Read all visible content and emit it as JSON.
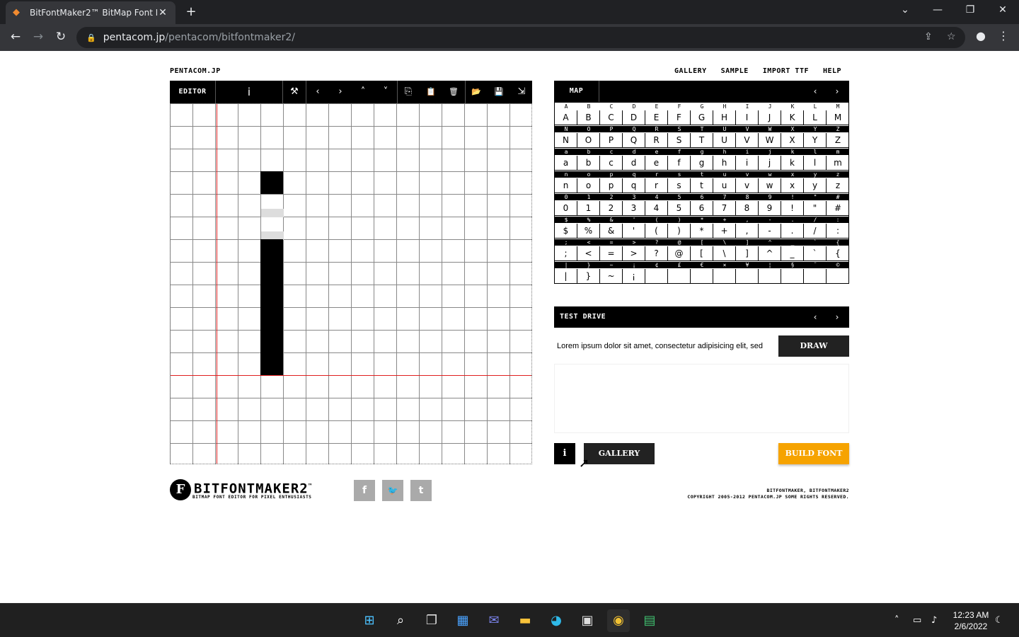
{
  "browser": {
    "tab_title": "BitFontMaker2™ BitMap Font Ed",
    "tab_close": "✕",
    "new_tab": "+",
    "url_host": "pentacom.jp",
    "url_path": "/pentacom/bitfontmaker2/",
    "win_min": "—",
    "win_max": "❐",
    "win_close": "✕",
    "tab_list": "⌄"
  },
  "site": {
    "name": "PENTACOM.JP",
    "nav": [
      "GALLERY",
      "SAMPLE",
      "IMPORT TTF",
      "HELP"
    ]
  },
  "editor": {
    "label": "EDITOR",
    "current_glyph": "i",
    "tools": {
      "magic": "⚒",
      "left": "‹",
      "right": "›",
      "up": "˄",
      "down": "˅",
      "copy": "⎘",
      "paste": "📋",
      "delete": "🗑",
      "open": "📂",
      "save": "💾",
      "export": "⇲"
    },
    "grid_cols": 16,
    "grid_rows": 16,
    "filled_pixels": [
      [
        4,
        3
      ],
      [
        4,
        6
      ],
      [
        4,
        7
      ],
      [
        4,
        8
      ],
      [
        4,
        9
      ],
      [
        4,
        10
      ],
      [
        4,
        11
      ]
    ],
    "ghost_pixels": [
      [
        4,
        4
      ],
      [
        4,
        5
      ]
    ],
    "guide_col": 2,
    "guide_row": 12
  },
  "footer": {
    "logo_badge": "F",
    "logo_name": "BITFONTMAKER2",
    "logo_tm": "™",
    "logo_sub": "BITMAP FONT EDITOR FOR PIXEL ENTHUSIASTS",
    "social": [
      "f",
      "🐦",
      "t"
    ],
    "copyright_line1": "BITFONTMAKER, BITFONTMAKER2",
    "copyright_line2": "COPYRIGHT 2005-2012 PENTACOM.JP SOME RIGHTS RESERVED."
  },
  "map": {
    "label": "MAP",
    "prev": "‹",
    "next": "›",
    "rows": [
      {
        "hdr": [
          "A",
          "B",
          "C",
          "D",
          "E",
          "F",
          "G",
          "H",
          "I",
          "J",
          "K",
          "L",
          "M"
        ],
        "cells": [
          "A",
          "B",
          "C",
          "D",
          "E",
          "F",
          "G",
          "H",
          "I",
          "J",
          "K",
          "L",
          "M"
        ]
      },
      {
        "hdr": [
          "N",
          "O",
          "P",
          "Q",
          "R",
          "S",
          "T",
          "U",
          "V",
          "W",
          "X",
          "Y",
          "Z"
        ],
        "cells": [
          "N",
          "O",
          "P",
          "Q",
          "R",
          "S",
          "T",
          "U",
          "V",
          "W",
          "X",
          "Y",
          "Z"
        ]
      },
      {
        "hdr": [
          "a",
          "b",
          "c",
          "d",
          "e",
          "f",
          "g",
          "h",
          "i",
          "j",
          "k",
          "l",
          "m"
        ],
        "cells": [
          "a",
          "b",
          "c",
          "d",
          "e",
          "f",
          "g",
          "h",
          "i",
          "j",
          "k",
          "l",
          "m"
        ]
      },
      {
        "hdr": [
          "n",
          "o",
          "p",
          "q",
          "r",
          "s",
          "t",
          "u",
          "v",
          "w",
          "x",
          "y",
          "z"
        ],
        "cells": [
          "n",
          "o",
          "p",
          "q",
          "r",
          "s",
          "t",
          "u",
          "v",
          "w",
          "x",
          "y",
          "z"
        ]
      },
      {
        "hdr": [
          "0",
          "1",
          "2",
          "3",
          "4",
          "5",
          "6",
          "7",
          "8",
          "9",
          "!",
          "\"",
          "#"
        ],
        "cells": [
          "0",
          "1",
          "2",
          "3",
          "4",
          "5",
          "6",
          "7",
          "8",
          "9",
          "!",
          "\"",
          "#"
        ]
      },
      {
        "hdr": [
          "$",
          "%",
          "&",
          "'",
          "(",
          ")",
          "*",
          "+",
          ",",
          "-",
          ".",
          "/",
          ":"
        ],
        "cells": [
          "$",
          "%",
          "&",
          "'",
          "(",
          ")",
          "*",
          "+",
          ",",
          "-",
          ".",
          "/",
          ":"
        ]
      },
      {
        "hdr": [
          ";",
          "<",
          "=",
          ">",
          "?",
          "@",
          "[",
          "\\",
          "]",
          "^",
          "_",
          "`",
          "{"
        ],
        "cells": [
          ";",
          "<",
          "=",
          ">",
          "?",
          "@",
          "[",
          "\\",
          "]",
          "^",
          "_",
          "`",
          "{"
        ]
      },
      {
        "hdr": [
          "|",
          "}",
          "~",
          "¡",
          "¢",
          "£",
          "€",
          "×",
          "¥",
          "¦",
          "§",
          "¨",
          "©"
        ],
        "cells": [
          "|",
          "}",
          "~",
          "¡",
          "",
          "",
          "",
          "",
          "",
          "",
          "",
          "",
          ""
        ]
      }
    ]
  },
  "test_drive": {
    "label": "TEST DRIVE",
    "prev": "‹",
    "next": "›",
    "input_value": "Lorem ipsum dolor sit amet, consectetur adipisicing elit, sed",
    "draw_label": "DRAW"
  },
  "actions": {
    "info_label": "i",
    "gallery_label": "GALLERY",
    "build_label": "BUILD FONT"
  },
  "taskbar": {
    "time": "12:23 AM",
    "date": "2/6/2022"
  }
}
